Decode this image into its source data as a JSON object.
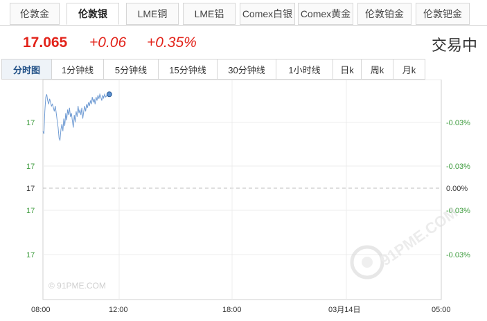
{
  "market_tabs": [
    {
      "label": "伦敦金",
      "active": false
    },
    {
      "label": "伦敦银",
      "active": true
    },
    {
      "label": "LME铜",
      "active": false
    },
    {
      "label": "LME铝",
      "active": false
    },
    {
      "label": "Comex白银",
      "active": false
    },
    {
      "label": "Comex黄金",
      "active": false
    },
    {
      "label": "伦敦铂金",
      "active": false
    },
    {
      "label": "伦敦钯金",
      "active": false
    }
  ],
  "quote": {
    "price": "17.065",
    "change": "+0.06",
    "change_pct": "+0.35%",
    "status": "交易中"
  },
  "period_tabs": [
    {
      "label": "分时图",
      "active": true
    },
    {
      "label": "1分钟线",
      "active": false
    },
    {
      "label": "5分钟线",
      "active": false
    },
    {
      "label": "15分钟线",
      "active": false
    },
    {
      "label": "30分钟线",
      "active": false
    },
    {
      "label": "1小时线",
      "active": false
    },
    {
      "label": "日k",
      "active": false
    },
    {
      "label": "周k",
      "active": false
    },
    {
      "label": "月k",
      "active": false
    }
  ],
  "colors": {
    "up": "#e2231a",
    "line": "#6f9bd3",
    "left_axis": "#3a9a3a",
    "right_axis": "#3a9a3a",
    "grid": "#e8e8e8"
  },
  "watermarks": {
    "small": "© 91PME.COM",
    "large": "91PME.COM"
  },
  "chart_data": {
    "type": "line",
    "x_ticks": [
      "08:00",
      "12:00",
      "18:00",
      "03月14日",
      "05:00"
    ],
    "y_ticks_left": [
      "17",
      "17",
      "17",
      "17",
      "17"
    ],
    "y_ticks_right": [
      "-0.03%",
      "-0.03%",
      "0.00%",
      "-0.03%",
      "-0.03%"
    ],
    "baseline_label": "0.00%",
    "x_range_hours": [
      0,
      21
    ],
    "series": [
      {
        "name": "",
        "x_hours": [
          0.0,
          0.05,
          0.1,
          0.15,
          0.2,
          0.25,
          0.3,
          0.35,
          0.4,
          0.45,
          0.5,
          0.55,
          0.6,
          0.65,
          0.7,
          0.75,
          0.8,
          0.85,
          0.9,
          0.95,
          1.0,
          1.05,
          1.1,
          1.15,
          1.2,
          1.25,
          1.3,
          1.35,
          1.4,
          1.45,
          1.5,
          1.55,
          1.6,
          1.65,
          1.7,
          1.75,
          1.8,
          1.85,
          1.9,
          1.95,
          2.0,
          2.05,
          2.1,
          2.15,
          2.2,
          2.25,
          2.3,
          2.35,
          2.4,
          2.45,
          2.5,
          2.55,
          2.6,
          2.65,
          2.7,
          2.75,
          2.8,
          2.85,
          2.9,
          2.95,
          3.0,
          3.05,
          3.1,
          3.15,
          3.2,
          3.25,
          3.3,
          3.35,
          3.4,
          3.45,
          3.5
        ],
        "values": [
          0.58,
          0.55,
          0.8,
          0.96,
          0.99,
          0.92,
          0.88,
          0.94,
          0.9,
          0.86,
          0.88,
          0.84,
          0.8,
          0.86,
          0.78,
          0.7,
          0.62,
          0.5,
          0.48,
          0.6,
          0.66,
          0.58,
          0.72,
          0.64,
          0.78,
          0.7,
          0.82,
          0.76,
          0.84,
          0.74,
          0.78,
          0.7,
          0.62,
          0.76,
          0.68,
          0.8,
          0.74,
          0.86,
          0.78,
          0.82,
          0.76,
          0.84,
          0.72,
          0.8,
          0.86,
          0.8,
          0.88,
          0.84,
          0.9,
          0.86,
          0.92,
          0.88,
          0.96,
          0.9,
          0.94,
          0.88,
          0.96,
          0.92,
          0.98,
          0.94,
          0.99,
          0.96,
          0.92,
          0.98,
          0.95,
          0.99,
          0.96,
          0.97,
          0.99,
          0.98,
          0.99
        ]
      }
    ]
  }
}
